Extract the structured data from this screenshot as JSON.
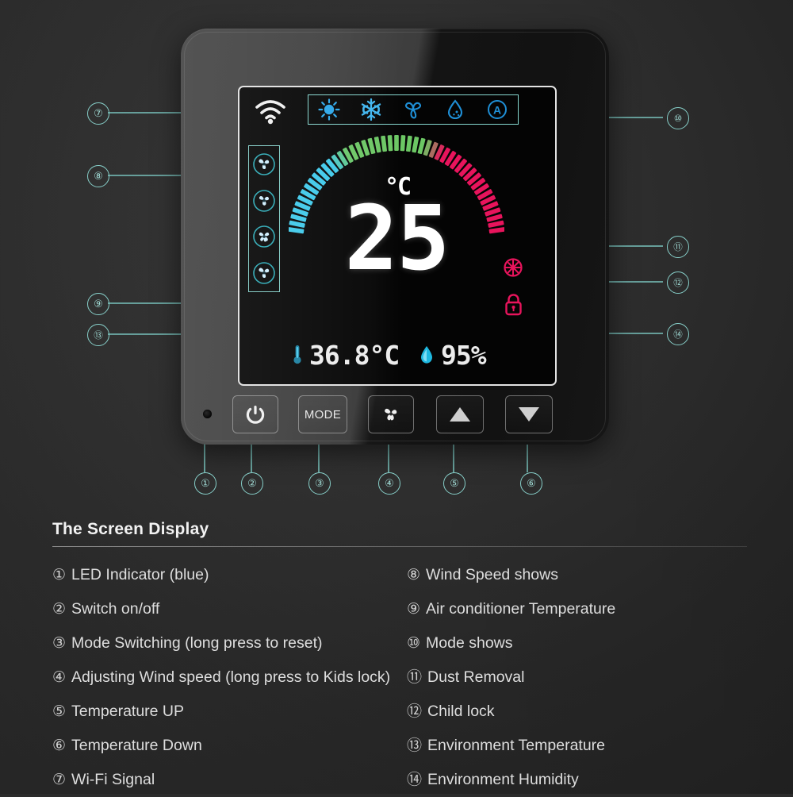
{
  "device": {
    "screen": {
      "wifi_icon": "wifi-signal-icon",
      "modes": [
        {
          "id": "heat",
          "icon": "sun-icon",
          "active": true,
          "color": "#2ba6e8"
        },
        {
          "id": "cool",
          "icon": "snowflake-icon",
          "active": true,
          "color": "#3fb5ef"
        },
        {
          "id": "fan",
          "icon": "fan-icon",
          "active": false,
          "color": "#1f8fd6"
        },
        {
          "id": "dry",
          "icon": "water-drop-icon",
          "active": false,
          "color": "#1f8fd6"
        },
        {
          "id": "auto",
          "icon": "auto-a-circle-icon",
          "active": false,
          "color": "#1f8fd6"
        }
      ],
      "wind_speed_levels": [
        {
          "id": "wind-level-1",
          "icon": "fan-icon"
        },
        {
          "id": "wind-level-2",
          "icon": "fan-icon"
        },
        {
          "id": "wind-level-3",
          "icon": "fan-icon"
        },
        {
          "id": "wind-level-4",
          "icon": "fan-icon"
        }
      ],
      "set_temperature": {
        "value": "25",
        "unit": "°C"
      },
      "gauge": {
        "ticks": 47,
        "colors": {
          "low": "#3ec9ea",
          "mid": "#6cc764",
          "high": "#e8145c"
        }
      },
      "status_icons": {
        "dust_removal": {
          "icon": "dust-removal-icon",
          "color": "#e8145c"
        },
        "child_lock": {
          "icon": "padlock-icon",
          "color": "#e8145c"
        }
      },
      "environment": {
        "temperature_icon": "thermometer-icon",
        "temperature": "36.8°C",
        "humidity_icon": "humidity-drop-icon",
        "humidity": "95%"
      }
    },
    "buttons": [
      {
        "id": "power-button",
        "label": "",
        "icon": "power-icon"
      },
      {
        "id": "mode-button",
        "label": "MODE",
        "icon": ""
      },
      {
        "id": "fan-speed-button",
        "label": "",
        "icon": "fan-icon"
      },
      {
        "id": "temp-up-button",
        "label": "",
        "icon": "triangle-up-icon"
      },
      {
        "id": "temp-down-button",
        "label": "",
        "icon": "triangle-down-icon"
      }
    ],
    "led_indicator": "led-indicator"
  },
  "callouts": {
    "1": "①",
    "2": "②",
    "3": "③",
    "4": "④",
    "5": "⑤",
    "6": "⑥",
    "7": "⑦",
    "8": "⑧",
    "9": "⑨",
    "10": "⑩",
    "11": "⑪",
    "12": "⑫",
    "13": "⑬",
    "14": "⑭"
  },
  "legend": {
    "title": "The Screen Display",
    "left": [
      {
        "num": "①",
        "text": "LED Indicator (blue)"
      },
      {
        "num": "②",
        "text": "Switch on/off"
      },
      {
        "num": "③",
        "text": "Mode Switching (long press to reset)"
      },
      {
        "num": "④",
        "text": "Adjusting Wind speed (long press to Kids lock)"
      },
      {
        "num": "⑤",
        "text": "Temperature UP"
      },
      {
        "num": "⑥",
        "text": "Temperature Down"
      },
      {
        "num": "⑦",
        "text": "Wi-Fi Signal"
      }
    ],
    "right": [
      {
        "num": "⑧",
        "text": "Wind Speed shows"
      },
      {
        "num": "⑨",
        "text": "Air conditioner Temperature"
      },
      {
        "num": "⑩",
        "text": "Mode shows"
      },
      {
        "num": "⑪",
        "text": "Dust Removal"
      },
      {
        "num": "⑫",
        "text": "Child lock"
      },
      {
        "num": "⑬",
        "text": "Environment Temperature"
      },
      {
        "num": "⑭",
        "text": "Environment Humidity"
      }
    ]
  },
  "colors": {
    "callout_line": "#79c3bd",
    "accent_blue": "#2ba6e8",
    "accent_red": "#e8145c",
    "page_bg": "#2e2e2e"
  }
}
